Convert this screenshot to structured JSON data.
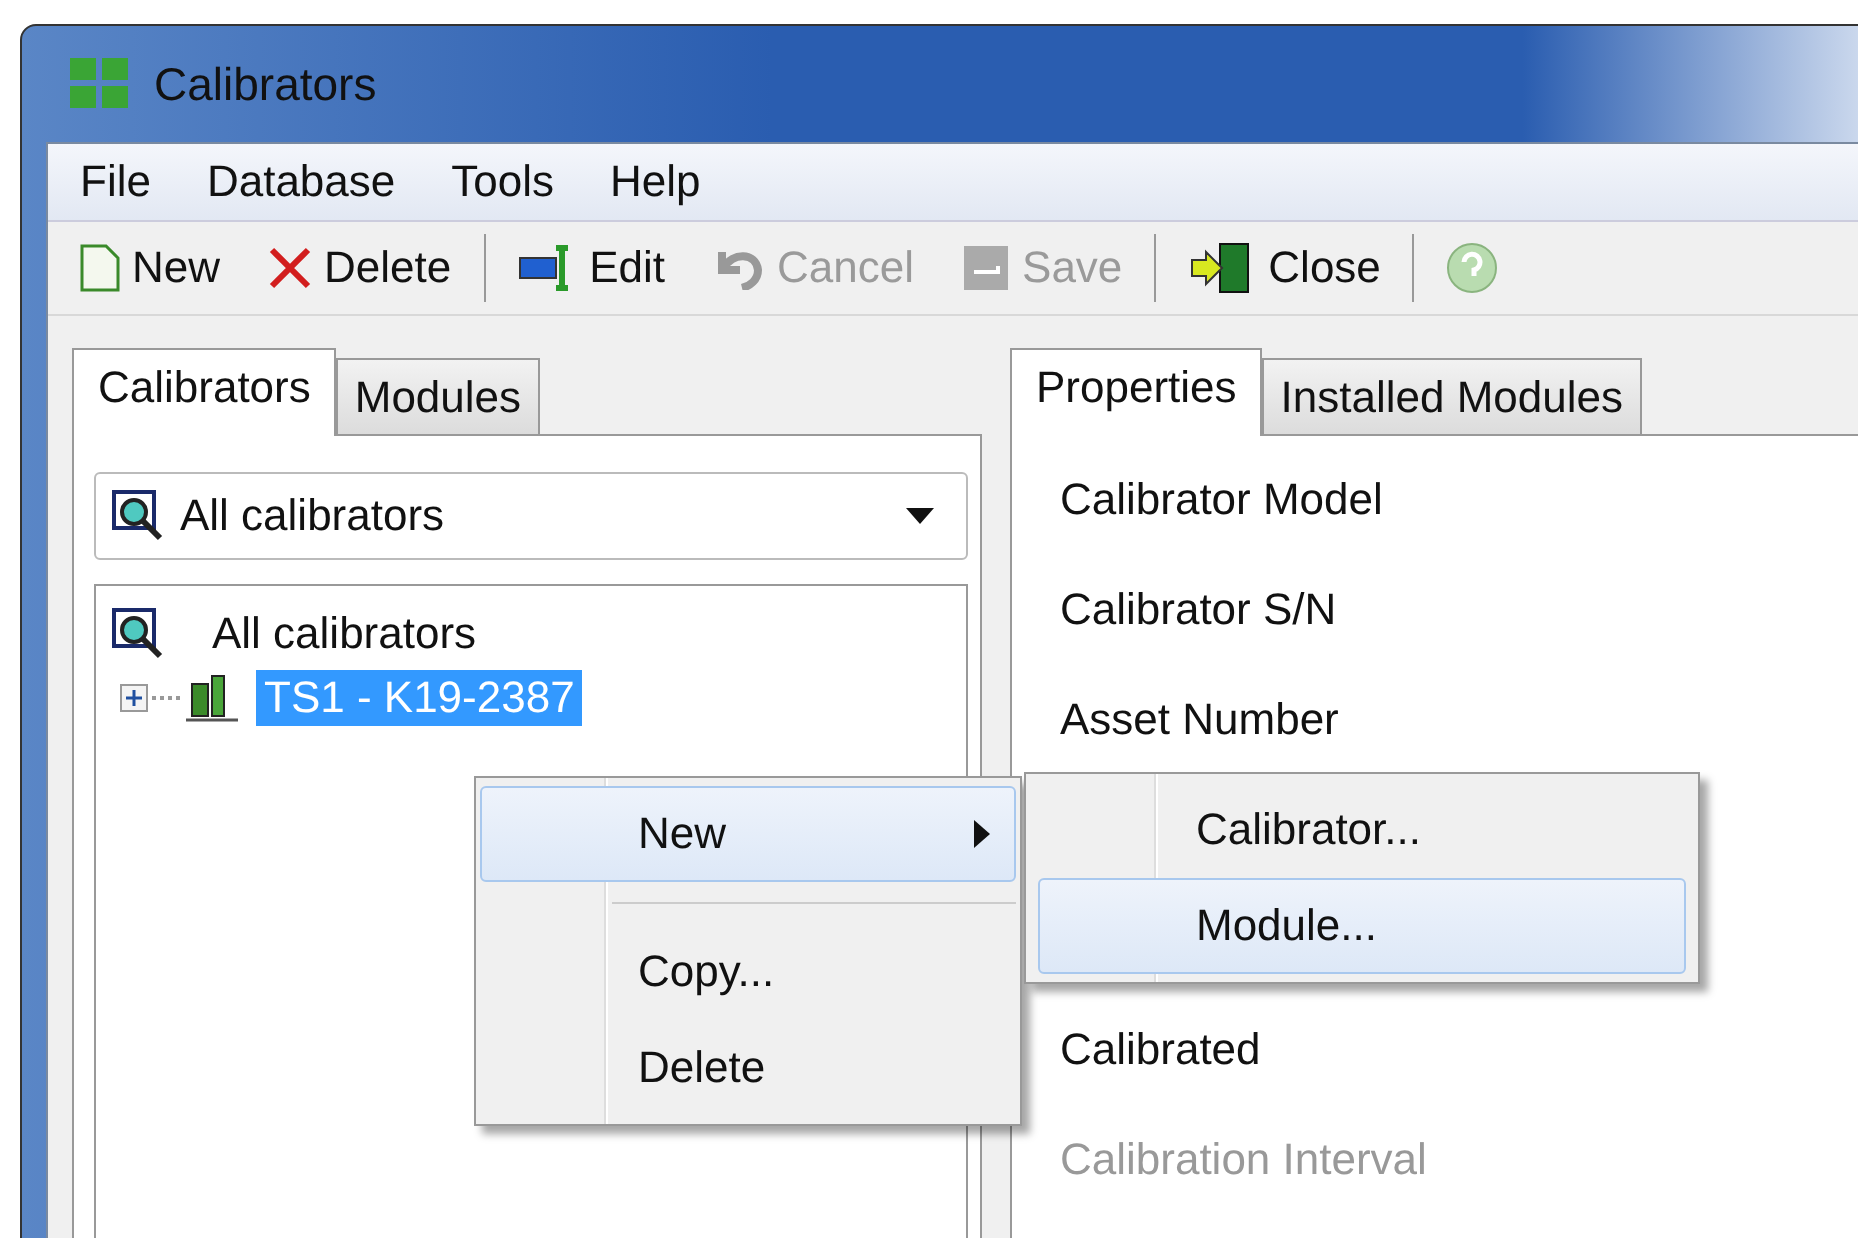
{
  "window": {
    "title": "Calibrators"
  },
  "menu_bar": [
    "File",
    "Database",
    "Tools",
    "Help"
  ],
  "toolbar": [
    {
      "kind": "button",
      "label": "New",
      "disabled": false
    },
    {
      "kind": "button",
      "label": "Delete",
      "disabled": false
    },
    {
      "kind": "separator"
    },
    {
      "kind": "button",
      "label": "Edit",
      "disabled": false
    },
    {
      "kind": "button",
      "label": "Cancel",
      "disabled": true
    },
    {
      "kind": "button",
      "label": "Save",
      "disabled": true
    },
    {
      "kind": "separator"
    },
    {
      "kind": "button",
      "label": "Close",
      "disabled": false
    },
    {
      "kind": "separator"
    },
    {
      "kind": "icon-button"
    }
  ],
  "left_tabs": [
    {
      "label": "Calibrators",
      "selected": true
    },
    {
      "label": "Modules",
      "selected": false
    }
  ],
  "filter_dropdown": {
    "value": "All calibrators"
  },
  "tree": [
    {
      "label": "All calibrators",
      "selected": false,
      "children": [
        {
          "label": "TS1 - K19-2387",
          "selected": true,
          "expanded": false
        }
      ]
    }
  ],
  "right_tabs": [
    {
      "label": "Properties",
      "selected": true
    },
    {
      "label": "Installed Modules",
      "selected": false
    }
  ],
  "properties": [
    {
      "label": "Calibrator Model",
      "disabled": false
    },
    {
      "label": "Calibrator S/N",
      "disabled": false
    },
    {
      "label": "Asset Number",
      "disabled": false
    },
    {
      "label": "Calibrated",
      "disabled": false
    },
    {
      "label": "Calibration Interval",
      "disabled": true
    }
  ],
  "context_menu": [
    {
      "kind": "item",
      "label": "New",
      "submenu": true,
      "selected": true
    },
    {
      "kind": "separator"
    },
    {
      "kind": "item",
      "label": "Copy...",
      "submenu": false,
      "selected": false
    },
    {
      "kind": "item",
      "label": "Delete",
      "submenu": false,
      "selected": false
    }
  ],
  "submenu": [
    {
      "label": "Calibrator...",
      "selected": false
    },
    {
      "label": "Module...",
      "selected": true
    }
  ]
}
